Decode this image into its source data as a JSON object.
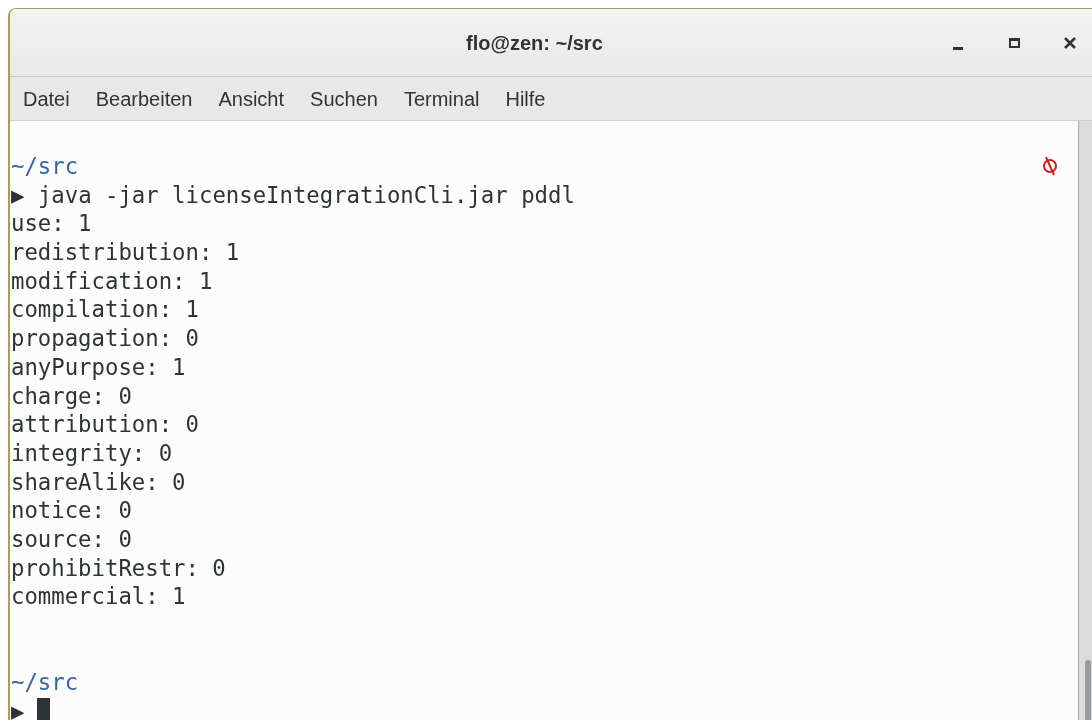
{
  "window": {
    "title": "flo@zen: ~/src"
  },
  "menu": [
    "Datei",
    "Bearbeiten",
    "Ansicht",
    "Suchen",
    "Terminal",
    "Hilfe"
  ],
  "terminal": {
    "lines": [
      {
        "kind": "dir",
        "text": "~/src"
      },
      {
        "kind": "command",
        "prompt": "▶",
        "text": "java -jar licenseIntegrationCli.jar pddl"
      },
      {
        "kind": "output",
        "text": "use: 1"
      },
      {
        "kind": "output",
        "text": "redistribution: 1"
      },
      {
        "kind": "output",
        "text": "modification: 1"
      },
      {
        "kind": "output",
        "text": "compilation: 1"
      },
      {
        "kind": "output",
        "text": "propagation: 0"
      },
      {
        "kind": "output",
        "text": "anyPurpose: 1"
      },
      {
        "kind": "output",
        "text": "charge: 0"
      },
      {
        "kind": "output",
        "text": "attribution: 0"
      },
      {
        "kind": "output",
        "text": "integrity: 0"
      },
      {
        "kind": "output",
        "text": "shareAlike: 0"
      },
      {
        "kind": "output",
        "text": "notice: 0"
      },
      {
        "kind": "output",
        "text": "source: 0"
      },
      {
        "kind": "output",
        "text": "prohibitRestr: 0"
      },
      {
        "kind": "output",
        "text": "commercial: 1"
      },
      {
        "kind": "blank"
      },
      {
        "kind": "blank"
      },
      {
        "kind": "dir",
        "text": "~/src"
      },
      {
        "kind": "cursor",
        "prompt": "▶"
      }
    ]
  }
}
